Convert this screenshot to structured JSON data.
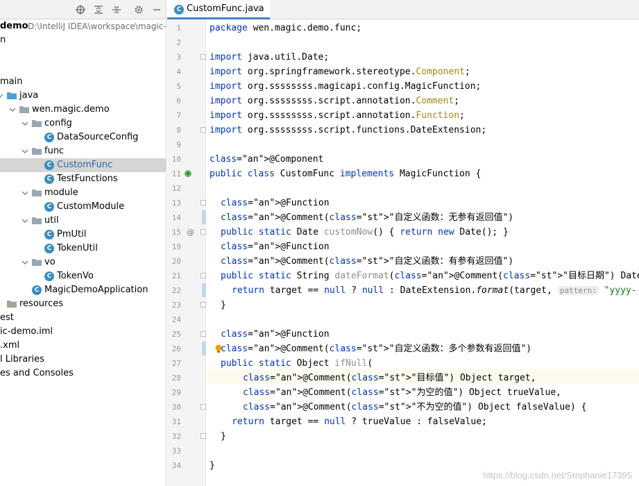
{
  "project": {
    "root_name": "demo",
    "root_path": "D:\\IntelliJ IDEA\\workspace\\magic-d",
    "tree": [
      {
        "label": "n",
        "indent": -4
      },
      {
        "label": "",
        "indent": 0
      },
      {
        "label": "",
        "indent": 0
      },
      {
        "label": "main",
        "indent": -4
      },
      {
        "label": "java",
        "indent": 10
      },
      {
        "label": "wen.magic.demo",
        "indent": 28
      },
      {
        "label": "config",
        "indent": 46
      },
      {
        "label": "DataSourceConfig",
        "indent": 64
      },
      {
        "label": "func",
        "indent": 46
      },
      {
        "label": "CustomFunc",
        "indent": 64
      },
      {
        "label": "TestFunctions",
        "indent": 64
      },
      {
        "label": "module",
        "indent": 46
      },
      {
        "label": "CustomModule",
        "indent": 64
      },
      {
        "label": "util",
        "indent": 46
      },
      {
        "label": "PmUtil",
        "indent": 64
      },
      {
        "label": "TokenUtil",
        "indent": 64
      },
      {
        "label": "vo",
        "indent": 46
      },
      {
        "label": "TokenVo",
        "indent": 64
      },
      {
        "label": "MagicDemoApplication",
        "indent": 46
      },
      {
        "label": "resources",
        "indent": 10
      },
      {
        "label": "est",
        "indent": -4
      },
      {
        "label": "ic-demo.iml",
        "indent": -4
      },
      {
        "label": ".xml",
        "indent": -4
      },
      {
        "label": "l Libraries",
        "indent": -4
      },
      {
        "label": "es and Consoles",
        "indent": -4
      }
    ]
  },
  "editor": {
    "tab_label": "CustomFunc.java",
    "tab_close": "×",
    "line_numbers": [
      "1",
      "2",
      "3",
      "4",
      "5",
      "6",
      "7",
      "8",
      "9",
      "10",
      "11",
      "12",
      "13",
      "14",
      "15",
      "19",
      "20",
      "21",
      "22",
      "23",
      "24",
      "25",
      "26",
      "27",
      "28",
      "29",
      "30",
      "31",
      "32",
      "33",
      "34"
    ],
    "lines": [
      "package wen.magic.demo.func;",
      "",
      "import java.util.Date;",
      "import org.springframework.stereotype.Component;",
      "import org.ssssssss.magicapi.config.MagicFunction;",
      "import org.ssssssss.script.annotation.Comment;",
      "import org.ssssssss.script.annotation.Function;",
      "import org.ssssssss.script.functions.DateExtension;",
      "",
      "@Component",
      "public class CustomFunc implements MagicFunction {",
      "",
      "@Function",
      "@Comment(\"自定义函数：无参有返回值\")",
      "public static Date customNow() { return new Date(); }",
      "@Function",
      "@Comment(\"自定义函数：有参有返回值\")",
      "public static String dateFormat(@Comment(\"目标日期\") Date target) {",
      "return target == null ? null : DateExtension.format(target,",
      "}",
      "",
      "@Function",
      "@Comment(\"自定义函数：多个参数有返回值\")",
      "public static Object ifNull(",
      "@Comment(\"目标值\") Object target,",
      "@Comment(\"为空的值\") Object trueValue,",
      "@Comment(\"不为空的值\") Object falseValue) {",
      "return target == null ? trueValue : falseValue;",
      "}",
      "",
      "}"
    ],
    "param_hint_label": "pattern:",
    "param_hint_value": "\"yyyy-"
  },
  "watermark": "https://blog.csdn.net/Stephanie17395"
}
